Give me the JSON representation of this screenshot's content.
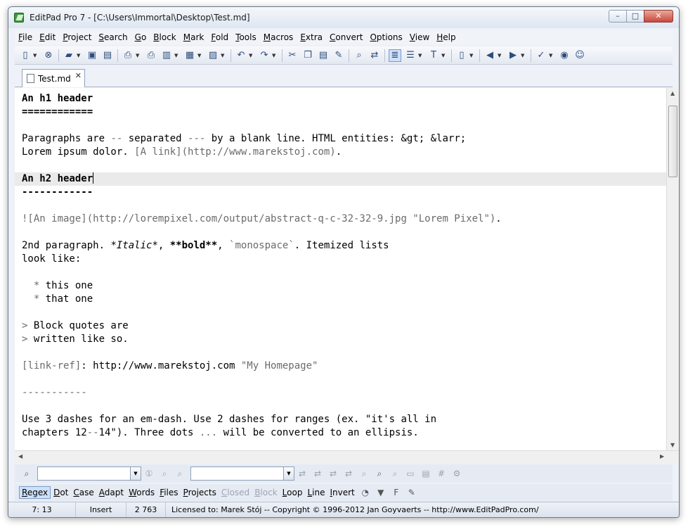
{
  "window": {
    "title": "EditPad Pro 7 - [C:\\Users\\Immortal\\Desktop\\Test.md]",
    "controls": {
      "minimize": "–",
      "maximize": "□",
      "close": "✕"
    }
  },
  "menu": [
    {
      "label": "File",
      "key": "F",
      "rest": "ile"
    },
    {
      "label": "Edit",
      "key": "E",
      "rest": "dit"
    },
    {
      "label": "Project",
      "key": "P",
      "rest": "roject"
    },
    {
      "label": "Search",
      "key": "S",
      "rest": "earch"
    },
    {
      "label": "Go",
      "key": "G",
      "rest": "o"
    },
    {
      "label": "Block",
      "key": "B",
      "rest": "lock"
    },
    {
      "label": "Mark",
      "key": "M",
      "rest": "ark"
    },
    {
      "label": "Fold",
      "key": "F",
      "rest": "old"
    },
    {
      "label": "Tools",
      "key": "T",
      "rest": "ools"
    },
    {
      "label": "Macros",
      "key": "M",
      "rest": "acros"
    },
    {
      "label": "Extra",
      "key": "E",
      "rest": "xtra"
    },
    {
      "label": "Convert",
      "key": "C",
      "rest": "onvert"
    },
    {
      "label": "Options",
      "key": "O",
      "rest": "ptions"
    },
    {
      "label": "View",
      "key": "V",
      "rest": "iew"
    },
    {
      "label": "Help",
      "key": "H",
      "rest": "elp"
    }
  ],
  "toolbar_icons": [
    "new-file-icon",
    "close-file-icon",
    "open-file-icon",
    "save-icon",
    "save-all-icon",
    "print-icon",
    "print-preview-icon",
    "file-history-icon",
    "project-icon",
    "bookmark-icon",
    "undo-icon",
    "redo-icon",
    "cut-icon",
    "copy-icon",
    "paste-icon",
    "clear-icon",
    "find-icon",
    "replace-icon",
    "word-wrap-icon",
    "align-icon",
    "font-icon",
    "new-doc-icon",
    "back-icon",
    "forward-icon",
    "spell-check-icon",
    "web-icon",
    "users-icon"
  ],
  "tab": {
    "label": "Test.md",
    "close": "✕"
  },
  "editor": {
    "lines": [
      {
        "segments": [
          {
            "t": "An h1 header",
            "s": "b"
          }
        ]
      },
      {
        "segments": [
          {
            "t": "============",
            "s": "b"
          }
        ]
      },
      {
        "segments": [
          {
            "t": "",
            "s": ""
          }
        ]
      },
      {
        "segments": [
          {
            "t": "Paragraphs are ",
            "s": ""
          },
          {
            "t": "--",
            "s": "g"
          },
          {
            "t": " separated ",
            "s": ""
          },
          {
            "t": "---",
            "s": "g"
          },
          {
            "t": " by a blank line. HTML entities: &gt; &larr;",
            "s": ""
          }
        ]
      },
      {
        "segments": [
          {
            "t": "Lorem ipsum dolor. ",
            "s": ""
          },
          {
            "t": "[A link](http://www.marekstoj.com)",
            "s": "g"
          },
          {
            "t": ".",
            "s": ""
          }
        ]
      },
      {
        "segments": [
          {
            "t": "",
            "s": ""
          }
        ]
      },
      {
        "segments": [
          {
            "t": "An h2 header",
            "s": "b"
          }
        ],
        "current": true
      },
      {
        "segments": [
          {
            "t": "------------",
            "s": "b"
          }
        ]
      },
      {
        "segments": [
          {
            "t": "",
            "s": ""
          }
        ]
      },
      {
        "segments": [
          {
            "t": "![An image](http://lorempixel.com/output/abstract-q-c-32-32-9.jpg \"Lorem Pixel\")",
            "s": "g"
          },
          {
            "t": ".",
            "s": ""
          }
        ]
      },
      {
        "segments": [
          {
            "t": "",
            "s": ""
          }
        ]
      },
      {
        "segments": [
          {
            "t": "2nd paragraph. ",
            "s": ""
          },
          {
            "t": "*Italic*",
            "s": "i"
          },
          {
            "t": ", ",
            "s": ""
          },
          {
            "t": "**bold**",
            "s": "b"
          },
          {
            "t": ", ",
            "s": ""
          },
          {
            "t": "`monospace`",
            "s": "g"
          },
          {
            "t": ". Itemized lists",
            "s": ""
          }
        ]
      },
      {
        "segments": [
          {
            "t": "look like:",
            "s": ""
          }
        ]
      },
      {
        "segments": [
          {
            "t": "",
            "s": ""
          }
        ]
      },
      {
        "segments": [
          {
            "t": "  * ",
            "s": "g"
          },
          {
            "t": "this one",
            "s": ""
          }
        ]
      },
      {
        "segments": [
          {
            "t": "  * ",
            "s": "g"
          },
          {
            "t": "that one",
            "s": ""
          }
        ]
      },
      {
        "segments": [
          {
            "t": "",
            "s": ""
          }
        ]
      },
      {
        "segments": [
          {
            "t": "> ",
            "s": "g"
          },
          {
            "t": "Block quotes are",
            "s": ""
          }
        ]
      },
      {
        "segments": [
          {
            "t": "> ",
            "s": "g"
          },
          {
            "t": "written like so.",
            "s": ""
          }
        ]
      },
      {
        "segments": [
          {
            "t": "",
            "s": ""
          }
        ]
      },
      {
        "segments": [
          {
            "t": "[link-ref]",
            "s": "g"
          },
          {
            "t": ": http://www.marekstoj.com ",
            "s": ""
          },
          {
            "t": "\"My Homepage\"",
            "s": "g"
          }
        ]
      },
      {
        "segments": [
          {
            "t": "",
            "s": ""
          }
        ]
      },
      {
        "segments": [
          {
            "t": "-----------",
            "s": "g"
          }
        ]
      },
      {
        "segments": [
          {
            "t": "",
            "s": ""
          }
        ]
      },
      {
        "segments": [
          {
            "t": "Use 3 dashes for an em-dash. Use 2 dashes for ranges (ex. \"it's all in",
            "s": ""
          }
        ]
      },
      {
        "segments": [
          {
            "t": "chapters 12",
            "s": ""
          },
          {
            "t": "--",
            "s": "g"
          },
          {
            "t": "14\"). Three dots ",
            "s": ""
          },
          {
            "t": "...",
            "s": "g"
          },
          {
            "t": " will be converted to an ellipsis.",
            "s": ""
          }
        ]
      }
    ]
  },
  "search_panel": {
    "search_value": "",
    "replace_value": ""
  },
  "options_bar": [
    {
      "label": "Regex",
      "key": "R",
      "rest": "egex",
      "state": "active"
    },
    {
      "label": "Dot",
      "key": "D",
      "rest": "ot",
      "state": "normal"
    },
    {
      "label": "Case",
      "key": "C",
      "rest": "ase",
      "state": "normal"
    },
    {
      "label": "Adapt",
      "key": "A",
      "rest": "dapt",
      "state": "normal"
    },
    {
      "label": "Words",
      "key": "W",
      "rest": "ords",
      "state": "normal"
    },
    {
      "label": "Files",
      "key": "F",
      "rest": "iles",
      "state": "normal"
    },
    {
      "label": "Projects",
      "key": "P",
      "rest": "rojects",
      "state": "normal"
    },
    {
      "label": "Closed",
      "key": "C",
      "rest": "losed",
      "state": "disabled"
    },
    {
      "label": "Block",
      "key": "B",
      "rest": "lock",
      "state": "disabled"
    },
    {
      "label": "Loop",
      "key": "L",
      "rest": "oop",
      "state": "normal"
    },
    {
      "label": "Line",
      "key": "L",
      "rest": "ine",
      "state": "normal"
    },
    {
      "label": "Invert",
      "key": "I",
      "rest": "nvert",
      "state": "normal"
    }
  ],
  "status": {
    "position": "7: 13",
    "mode": "Insert",
    "length": "2 763",
    "license": "Licensed to: Marek Stój  --  Copyright © 1996-2012  Jan Goyvaerts  --  http://www.EditPadPro.com/"
  }
}
